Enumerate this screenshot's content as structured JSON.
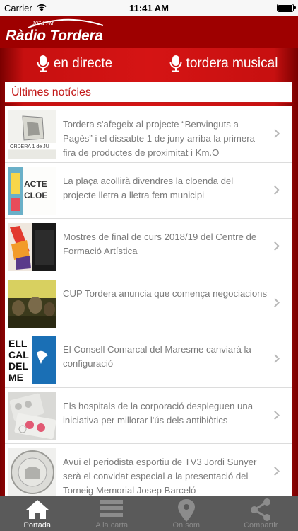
{
  "status_bar": {
    "carrier": "Carrier",
    "time": "11:41 AM"
  },
  "header": {
    "logo_name": "Ràdio Tordera",
    "logo_frequency": "107.1 FM"
  },
  "radio_buttons": [
    {
      "label": "en directe",
      "icon": "microphone-icon"
    },
    {
      "label": "tordera musical",
      "icon": "microphone-icon"
    }
  ],
  "section": {
    "title": "Últimes notícies"
  },
  "news": [
    {
      "title": "Tordera s'afegeix al projecte “Benvinguts a Pagès” i el dissabte 1 de juny arriba la primera fira de productes de proximitat i Km.O",
      "thumb_text": "ORDERA 1 de JU"
    },
    {
      "title": "La plaça acollirà divendres la cloenda del projecte lletra a lletra fem municipi",
      "thumb_text": "ACTE CLOE"
    },
    {
      "title": "Mostres de final de curs 2018/19 del Centre de Formació Artística",
      "thumb_text": ""
    },
    {
      "title": "CUP Tordera anuncia que comença negociacions",
      "thumb_text": ""
    },
    {
      "title": "El Consell Comarcal del Maresme canviarà la configuració",
      "thumb_text": "ELL CAL DEL ME"
    },
    {
      "title": "Els hospitals de la corporació despleguen una iniciativa per millorar l'ús dels antibiòtics",
      "thumb_text": ""
    },
    {
      "title": "Avui el periodista esportiu de TV3 Jordi Sunyer serà el convidat especial a la presentació del Torneig Memorial Josep Barceló",
      "thumb_text": ""
    }
  ],
  "tabs": [
    {
      "label": "Portada",
      "icon": "home-icon",
      "active": true
    },
    {
      "label": "A la carta",
      "icon": "list-icon",
      "active": false
    },
    {
      "label": "On som",
      "icon": "location-pin-icon",
      "active": false
    },
    {
      "label": "Compartir",
      "icon": "share-icon",
      "active": false
    }
  ],
  "colors": {
    "brand_red": "#c21818",
    "header_red": "#9e0000",
    "tab_bar": "#5a5a5a",
    "text_gray": "#7a7a7a"
  }
}
